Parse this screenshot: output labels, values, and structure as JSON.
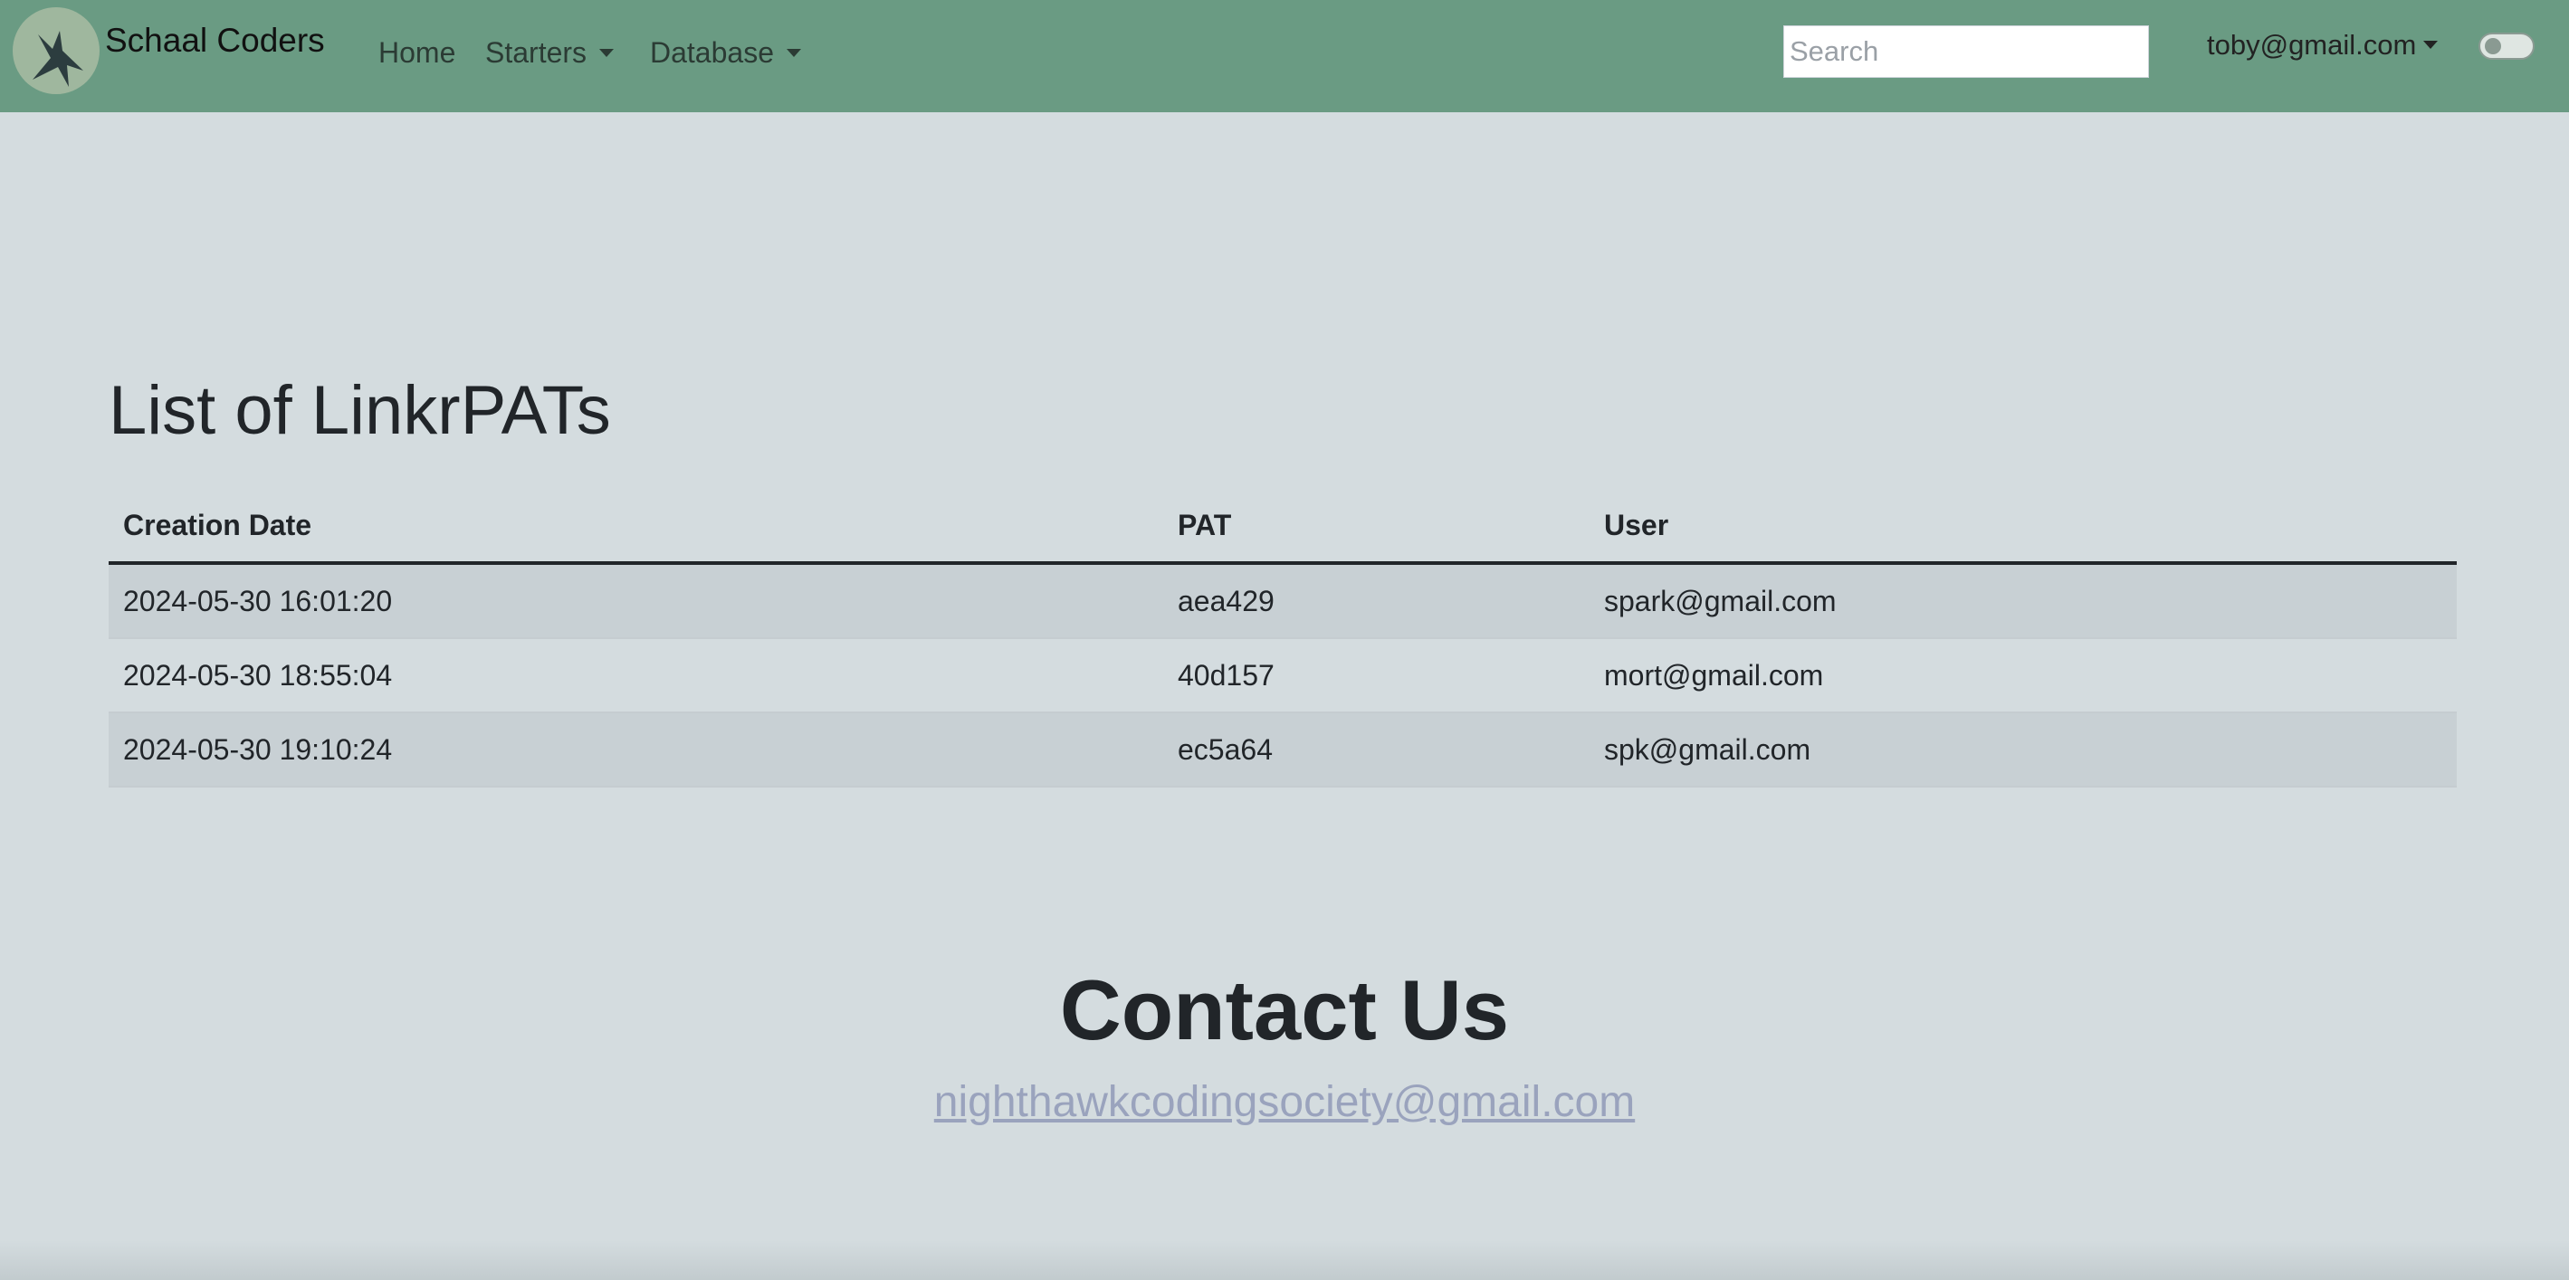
{
  "navbar": {
    "brand": "Schaal Coders",
    "logo_icon": "hawk-icon",
    "links": [
      {
        "label": "Home",
        "dropdown": false
      },
      {
        "label": "Starters",
        "dropdown": true
      },
      {
        "label": "Database",
        "dropdown": true
      }
    ],
    "search_placeholder": "Search",
    "user_email": "toby@gmail.com",
    "theme_toggle_on": false,
    "colors": {
      "navbar_bg": "#6a9b83",
      "page_bg": "#d4dcdf"
    }
  },
  "main": {
    "title": "List of LinkrPATs",
    "table": {
      "headers": [
        "Creation Date",
        "PAT",
        "User"
      ],
      "rows": [
        [
          "2024-05-30 16:01:20",
          "aea429",
          "spark@gmail.com"
        ],
        [
          "2024-05-30 18:55:04",
          "40d157",
          "mort@gmail.com"
        ],
        [
          "2024-05-30 19:10:24",
          "ec5a64",
          "spk@gmail.com"
        ]
      ]
    }
  },
  "footer": {
    "contact_title": "Contact Us",
    "contact_email": "nighthawkcodingsociety@gmail.com",
    "link_color": "#9aa3bd"
  }
}
